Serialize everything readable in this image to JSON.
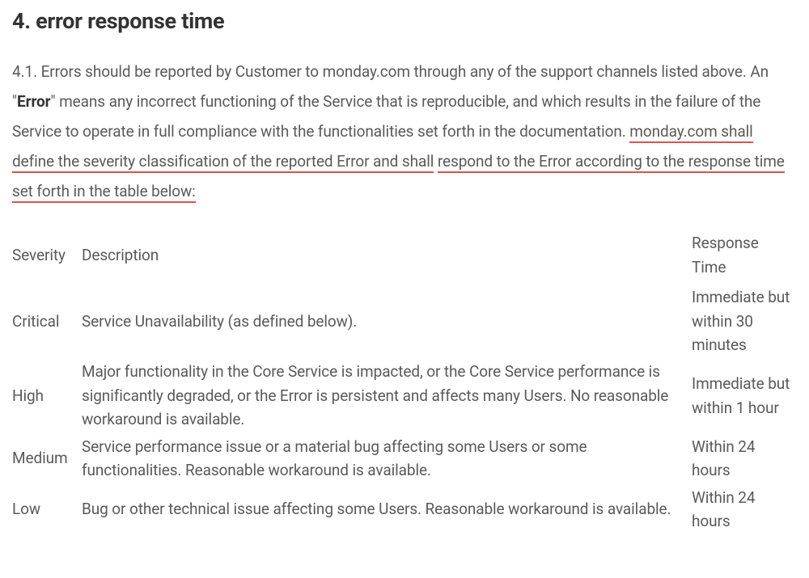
{
  "heading": "4. error response time",
  "paragraph": {
    "prefix": "4.1.   Errors should be reported by Customer to monday.com through any of the support channels listed above. An \"",
    "bold_term": "Error",
    "middle": "\" means any incorrect functioning of the Service that is reproducible, and which results in the failure of the Service to operate in full compliance with the functionalities set forth in the documentation. ",
    "underlined1": "monday.com shall define the severity classification of the reported Error and shall",
    "underlined2": "respond to the Error according to the response time set forth in the table below:"
  },
  "table": {
    "headers": {
      "severity": "Severity",
      "description": "Description",
      "response": "Response Time"
    },
    "rows": [
      {
        "severity": "Critical",
        "description": "Service Unavailability (as defined below).",
        "response": "Immediate but within 30 minutes"
      },
      {
        "severity": "High",
        "description": "Major functionality in the Core Service is impacted, or the Core Service performance is significantly degraded, or the Error is persistent and affects many Users. No reasonable workaround is available.",
        "response": "Immediate but within 1 hour"
      },
      {
        "severity": "Medium",
        "description": "Service performance issue or a material bug affecting some Users or some functionalities. Reasonable workaround is available.",
        "response": "Within 24 hours"
      },
      {
        "severity": "Low",
        "description": "Bug or other technical issue affecting some Users. Reasonable workaround is available.",
        "response": "Within 24 hours"
      }
    ]
  }
}
